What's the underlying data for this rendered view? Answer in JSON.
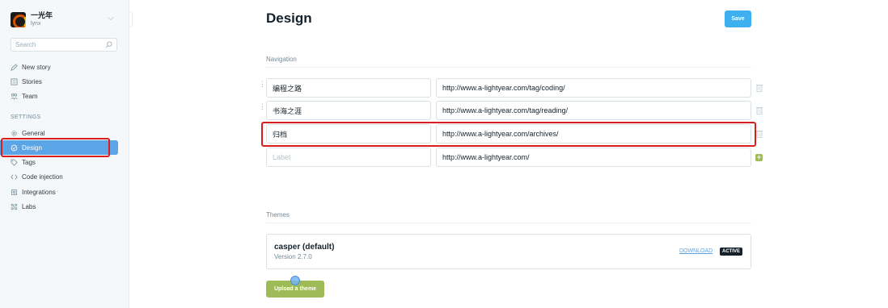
{
  "brand": {
    "title": "一光年",
    "user": "lynx"
  },
  "search": {
    "placeholder": "Search"
  },
  "sidebar": {
    "main_items": [
      {
        "label": "New story",
        "icon": "pen-icon"
      },
      {
        "label": "Stories",
        "icon": "list-icon"
      },
      {
        "label": "Team",
        "icon": "team-icon"
      }
    ],
    "settings_label": "SETTINGS",
    "settings_items": [
      {
        "label": "General",
        "icon": "gear-icon"
      },
      {
        "label": "Design",
        "icon": "palette-icon",
        "active": true
      },
      {
        "label": "Tags",
        "icon": "tag-icon"
      },
      {
        "label": "Code injection",
        "icon": "code-icon"
      },
      {
        "label": "Integrations",
        "icon": "integrations-icon"
      },
      {
        "label": "Labs",
        "icon": "labs-icon"
      }
    ]
  },
  "page": {
    "title": "Design",
    "save_label": "Save"
  },
  "navigation": {
    "heading": "Navigation",
    "items": [
      {
        "label": "编程之路",
        "url": "http://www.a-lightyear.com/tag/coding/"
      },
      {
        "label": "书海之涯",
        "url": "http://www.a-lightyear.com/tag/reading/"
      },
      {
        "label": "归档",
        "url": "http://www.a-lightyear.com/archives/"
      }
    ],
    "new_item": {
      "label_placeholder": "Label",
      "url": "http://www.a-lightyear.com/"
    }
  },
  "themes": {
    "heading": "Themes",
    "theme": {
      "name": "casper (default)",
      "version": "Version 2.7.0",
      "download_label": "DOWNLOAD",
      "status": "ACTIVE"
    },
    "upload_label": "Upload a theme"
  },
  "colors": {
    "accent": "#3eb0ef",
    "active_nav": "#5ba4e5",
    "green": "#9fbb58",
    "highlight": "#d81d1d"
  }
}
